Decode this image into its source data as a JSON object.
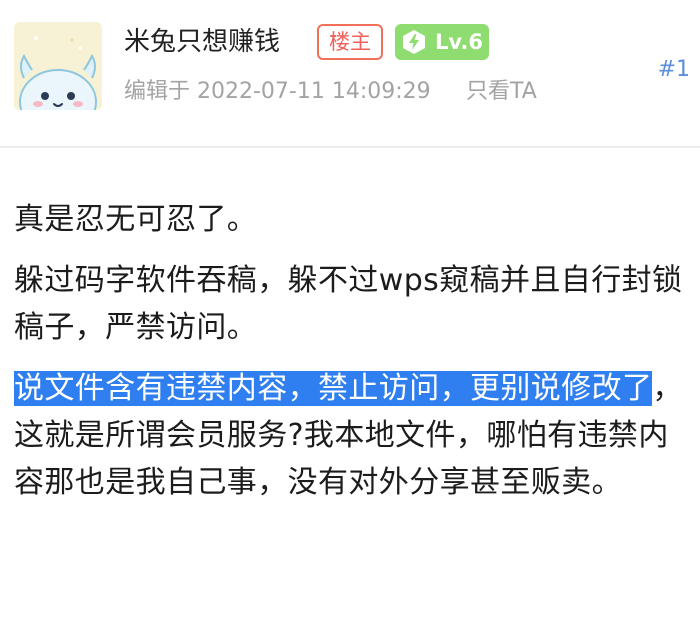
{
  "post": {
    "username": "米兔只想赚钱",
    "op_badge": "楼主",
    "level_badge": "Lv.6",
    "edit_meta": "编辑于 2022-07-11 14:09:29",
    "only_ta": "只看TA",
    "floor": "#1"
  },
  "colors": {
    "op_badge": "#f0605a",
    "level_badge_bg": "#8fdc70",
    "highlight_bg": "#2f7ff0",
    "floor_link": "#5b8fd8"
  },
  "icons": {
    "level": "lightning-hexagon-icon",
    "avatar": "cartoon-rabbit-avatar"
  },
  "content": {
    "p1": "真是忍无可忍了。",
    "p2": "躲过码字软件吞稿，躲不过wps窥稿并且自行封锁稿子，严禁访问。",
    "p3_highlighted": "说文件含有违禁内容，禁止访问，更别说修改了",
    "p3_rest": "，这就是所谓会员服务?我本地文件，哪怕有违禁内容那也是我自己事，没有对外分享甚至贩卖。"
  }
}
